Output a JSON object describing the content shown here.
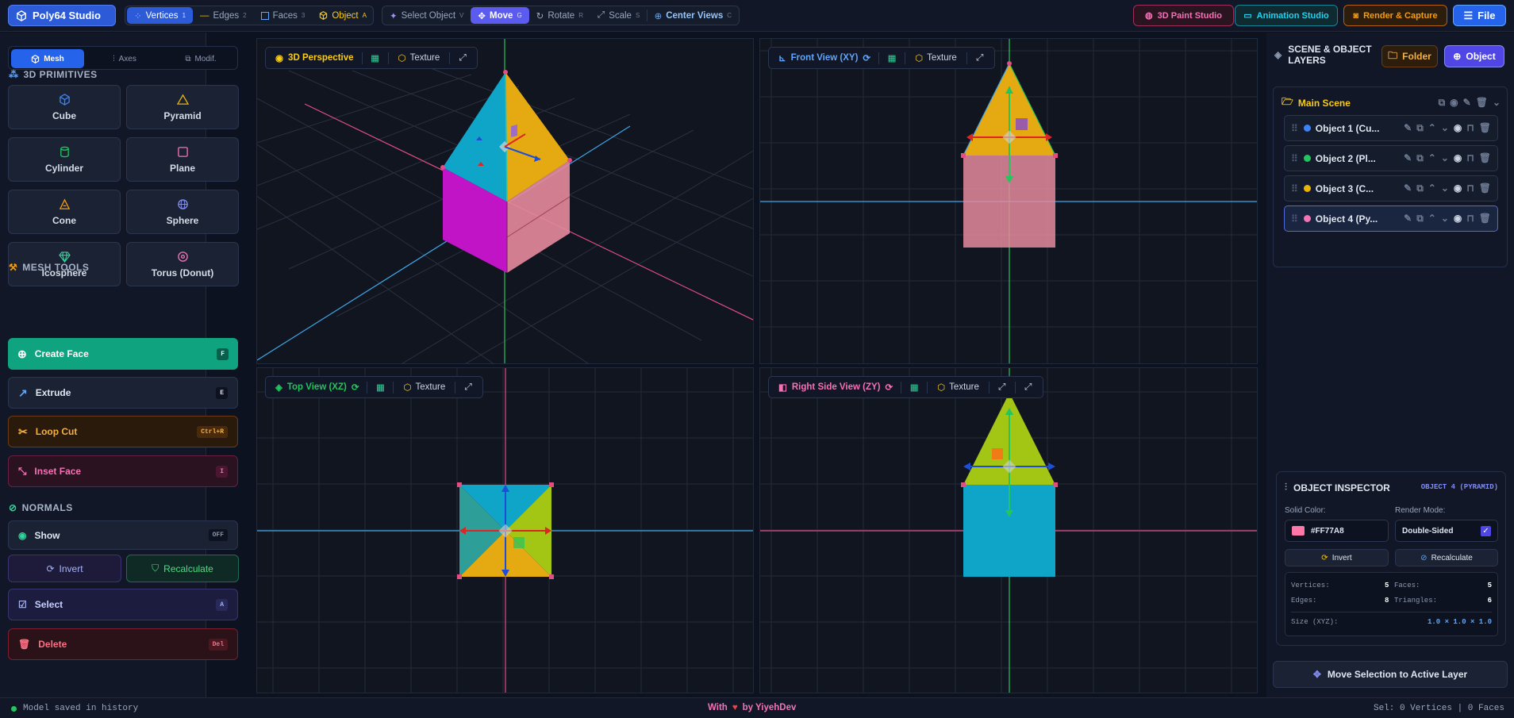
{
  "app": {
    "title": "Poly64 Studio"
  },
  "toolbar": {
    "modes": [
      {
        "label": "Vertices",
        "key": "1"
      },
      {
        "label": "Edges",
        "key": "2"
      },
      {
        "label": "Faces",
        "key": "3"
      },
      {
        "label": "Object",
        "key": "A"
      }
    ],
    "tools": [
      {
        "label": "Select Object",
        "key": "V"
      },
      {
        "label": "Move",
        "key": "G"
      },
      {
        "label": "Rotate",
        "key": "R"
      },
      {
        "label": "Scale",
        "key": "S"
      },
      {
        "label": "Center Views",
        "key": "C"
      }
    ],
    "right": {
      "paint": "3D Paint Studio",
      "anim": "Animation Studio",
      "render": "Render & Capture",
      "file": "File"
    }
  },
  "left": {
    "tabs": [
      "Mesh",
      "Axes",
      "Modif."
    ],
    "primitives_title": "3D PRIMITIVES",
    "primitives": [
      "Cube",
      "Pyramid",
      "Cylinder",
      "Plane",
      "Cone",
      "Sphere",
      "Icosphere",
      "Torus (Donut)"
    ],
    "mesh_tools_title": "MESH TOOLS",
    "tools": [
      {
        "label": "Create Face",
        "key": "F"
      },
      {
        "label": "Extrude",
        "key": "E"
      },
      {
        "label": "Loop Cut",
        "key": "Ctrl+R"
      },
      {
        "label": "Inset Face",
        "key": "I"
      }
    ],
    "normals_title": "NORMALS",
    "show": {
      "label": "Show",
      "state": "OFF"
    },
    "invert": "Invert",
    "recalculate": "Recalculate",
    "select": {
      "label": "Select",
      "key": "A"
    },
    "delete": {
      "label": "Delete",
      "key": "Del"
    }
  },
  "viewports": {
    "texture": "Texture",
    "persp": "3D Perspective",
    "front": "Front View (XY)",
    "top": "Top View (XZ)",
    "side": "Right Side View (ZY)"
  },
  "right": {
    "title": "SCENE & OBJECT LAYERS",
    "folder_btn": "Folder",
    "object_btn": "Object",
    "scene": "Main Scene",
    "layers": [
      {
        "label": "Object 1 (Cu...",
        "color": "#3b82f6"
      },
      {
        "label": "Object 2 (Pl...",
        "color": "#22c55e"
      },
      {
        "label": "Object 3 (C...",
        "color": "#eab308"
      },
      {
        "label": "Object 4 (Py...",
        "color": "#f472b6"
      }
    ],
    "inspector": {
      "title": "OBJECT INSPECTOR",
      "object": "OBJECT 4 (PYRAMID)",
      "solid_color_label": "Solid Color:",
      "render_mode_label": "Render Mode:",
      "color": "#FF77A8",
      "render_mode": "Double-Sided",
      "invert": "Invert",
      "recalculate": "Recalculate",
      "stats": {
        "vertices_label": "Vertices:",
        "vertices": "5",
        "faces_label": "Faces:",
        "faces": "5",
        "edges_label": "Edges:",
        "edges": "8",
        "triangles_label": "Triangles:",
        "triangles": "6",
        "size_label": "Size (XYZ):",
        "size": "1.0 × 1.0 × 1.0"
      }
    },
    "move_btn": "Move Selection to Active Layer"
  },
  "status": {
    "left": "Model saved in history",
    "with": "With",
    "by": "by YiyehDev",
    "right": "Sel: 0 Vertices | 0 Faces"
  }
}
